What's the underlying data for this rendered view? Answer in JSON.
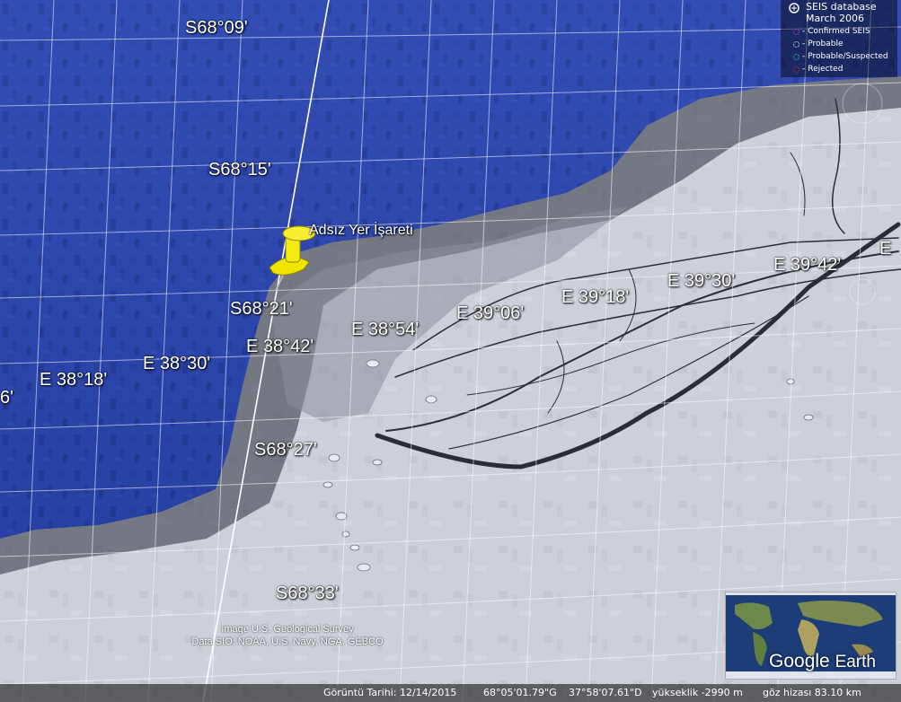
{
  "map": {
    "grid_labels": {
      "lat_1": "S68°09'",
      "lat_2": "S68°15'",
      "lat_3": "S68°21'",
      "lat_4": "S68°27'",
      "lat_5": "S68°33'",
      "lon_0": "6'",
      "lon_1": "E 38°18'",
      "lon_2": "E 38°30'",
      "lon_3": "E 38°42'",
      "lon_4": "E 38°54'",
      "lon_5": "E 39°06'",
      "lon_6": "E 39°18'",
      "lon_7": "E 39°30'",
      "lon_8": "E 39°42'",
      "lon_9": "E"
    },
    "placemark": {
      "label": "Adsız Yer İşareti",
      "icon": "yellow-pushpin-icon",
      "color": "#f2e400"
    },
    "colors": {
      "ocean": "#2a44a8",
      "ice": "#c9cdd6",
      "grid": "#ffffff"
    }
  },
  "credits": {
    "line1": "Image U.S. Geological Survey",
    "line2": "Data SIO, NOAA, U.S. Navy, NGA, GEBCO"
  },
  "legend": {
    "title_line1": "SEIS database",
    "title_line2": "March 2006",
    "items": [
      {
        "label": "Confirmed SEIS",
        "color": "#d040d0"
      },
      {
        "label": "Probable",
        "color": "#ffffff"
      },
      {
        "label": "Probable/Suspected",
        "color": "#30d0d0"
      },
      {
        "label": "Rejected",
        "color": "#e02020"
      }
    ]
  },
  "status": {
    "date": "Görüntü Tarihi: 12/14/2015",
    "lat": "68°05'01.79\"G",
    "lon": "37°58'07.61\"D",
    "elevation": "yükseklik -2990 m",
    "eye": "göz hizası  83.10 km"
  },
  "logo": {
    "google": "Google",
    "earth": "Earth"
  }
}
